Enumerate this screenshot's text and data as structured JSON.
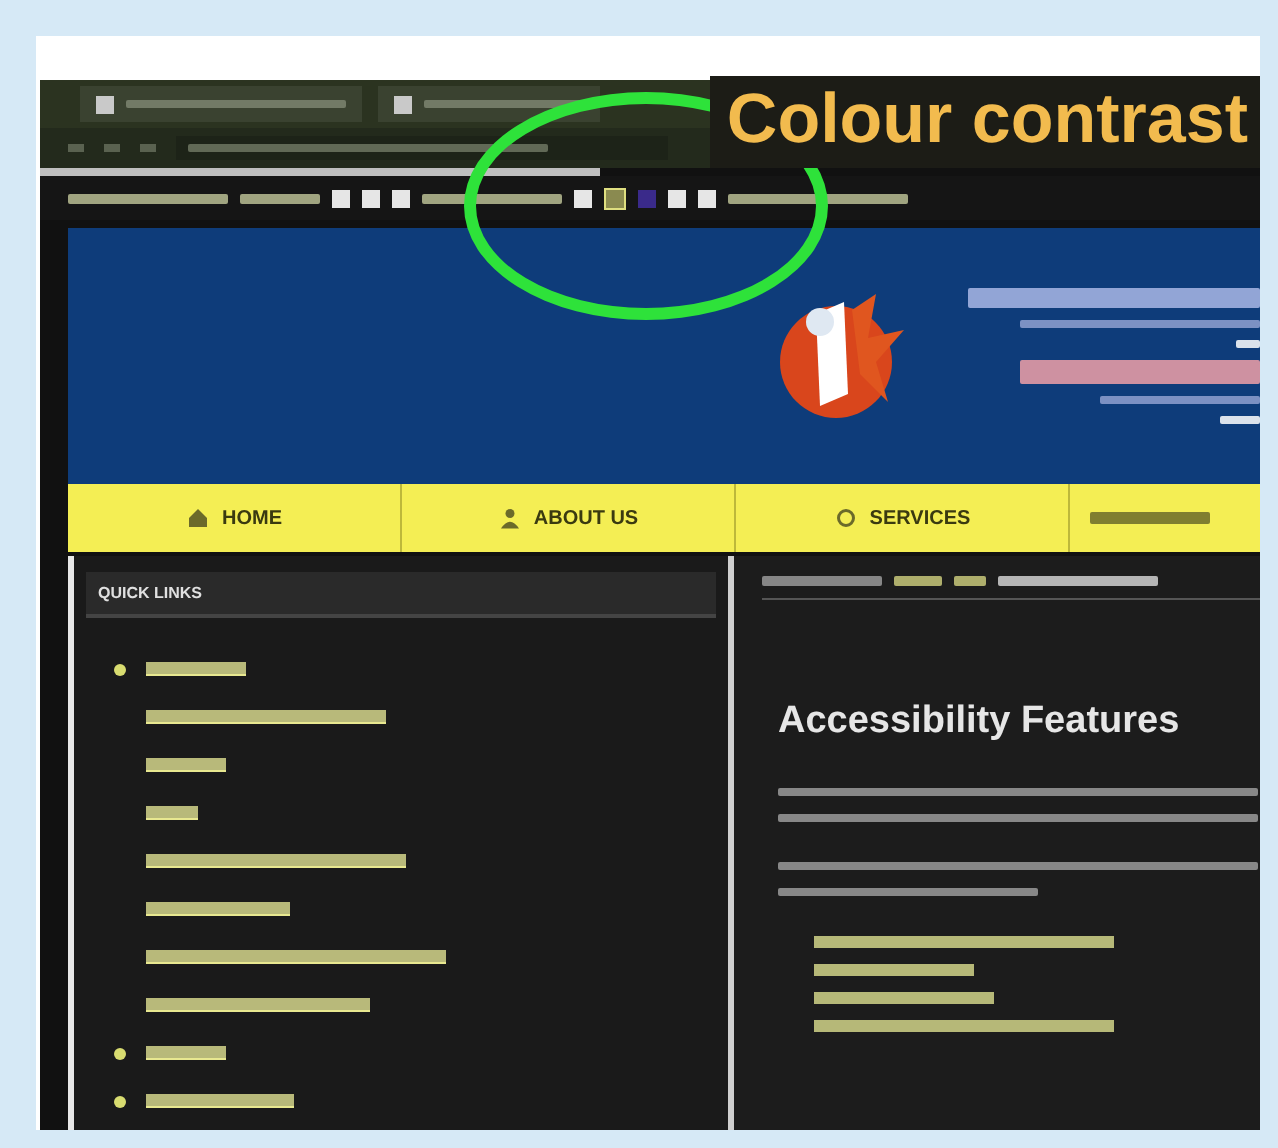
{
  "overlay": {
    "caption": "Colour contrast"
  },
  "nav": [
    {
      "label": "HOME",
      "kind": "home"
    },
    {
      "label": "ABOUT US",
      "kind": "about"
    },
    {
      "label": "SERVICES",
      "kind": "services"
    }
  ],
  "sidebar": {
    "title": "QUICK LINKS"
  },
  "main": {
    "heading": "Accessibility Features"
  }
}
